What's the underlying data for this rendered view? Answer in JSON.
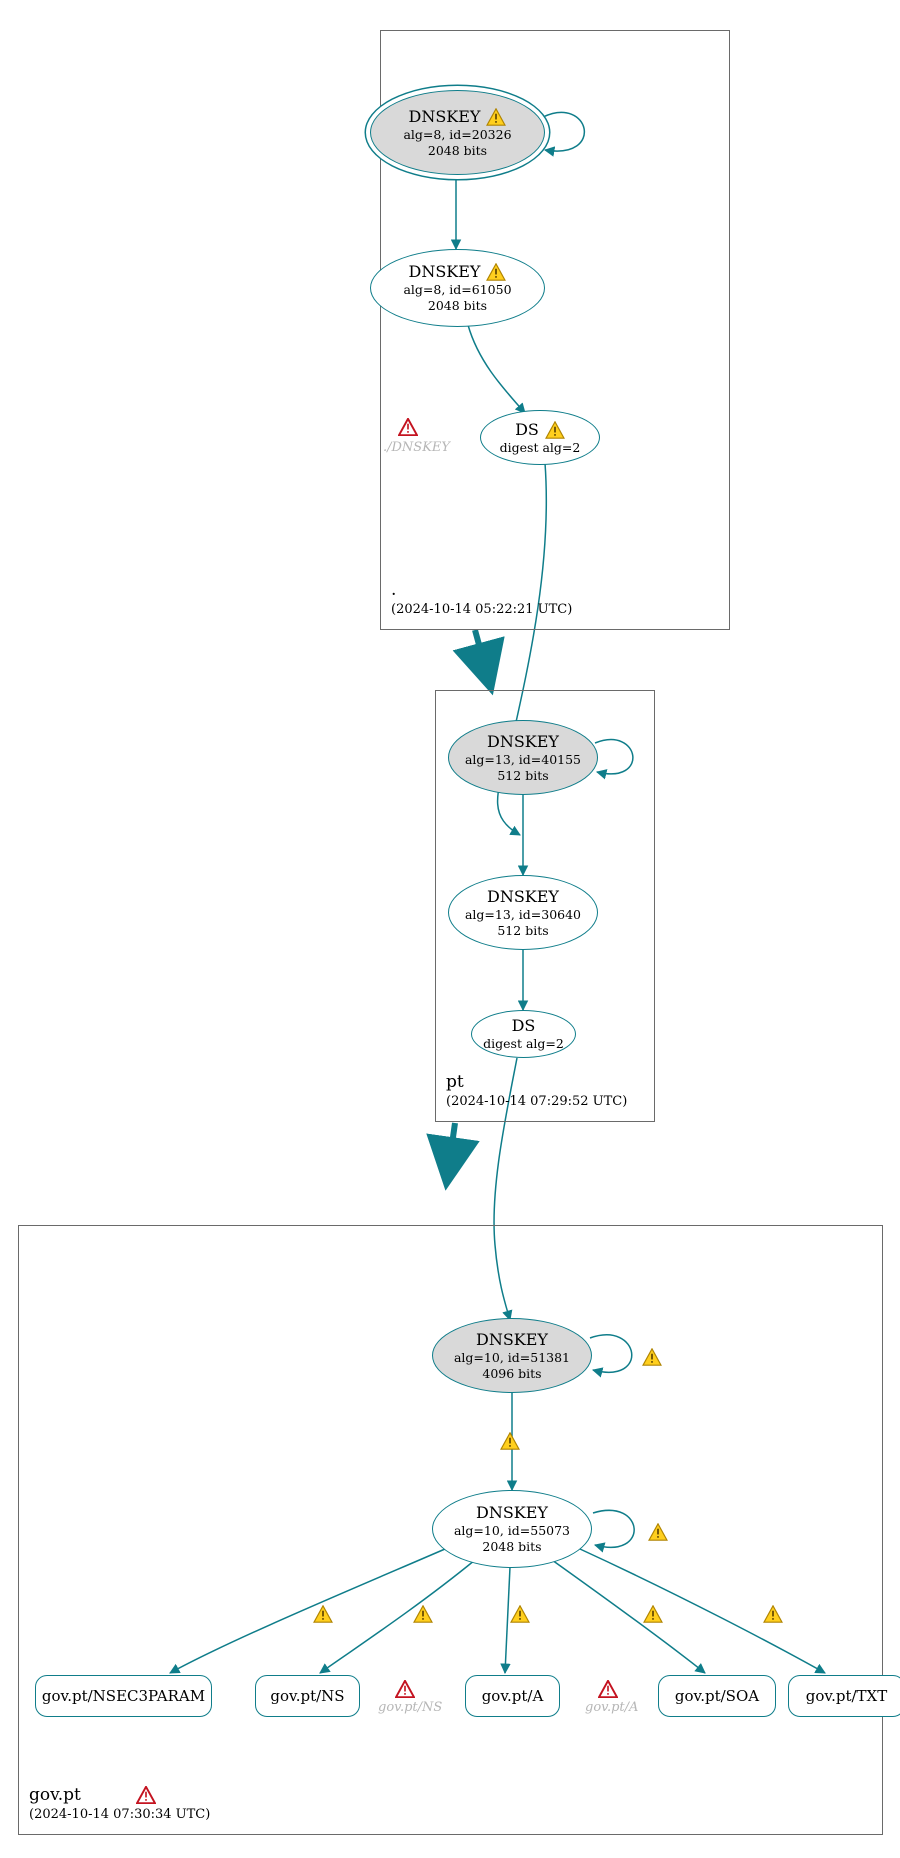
{
  "colors": {
    "teal": "#0f7d8a",
    "ghost": "#b6b6b6"
  },
  "zones": {
    "root": {
      "name": ".",
      "timestamp": "(2024-10-14 05:22:21 UTC)"
    },
    "pt": {
      "name": "pt",
      "timestamp": "(2024-10-14 07:29:52 UTC)"
    },
    "govpt": {
      "name": "gov.pt",
      "timestamp": "(2024-10-14 07:30:34 UTC)"
    }
  },
  "nodes": {
    "root_ksk": {
      "title": "DNSKEY",
      "meta1": "alg=8, id=20326",
      "meta2": "2048 bits",
      "warn": "yellow"
    },
    "root_zsk": {
      "title": "DNSKEY",
      "meta1": "alg=8, id=61050",
      "meta2": "2048 bits",
      "warn": "yellow"
    },
    "root_ds": {
      "title": "DS",
      "meta1": "digest alg=2",
      "warn": "yellow"
    },
    "pt_ksk": {
      "title": "DNSKEY",
      "meta1": "alg=13, id=40155",
      "meta2": "512 bits"
    },
    "pt_zsk": {
      "title": "DNSKEY",
      "meta1": "alg=13, id=30640",
      "meta2": "512 bits"
    },
    "pt_ds": {
      "title": "DS",
      "meta1": "digest alg=2"
    },
    "gov_ksk": {
      "title": "DNSKEY",
      "meta1": "alg=10, id=51381",
      "meta2": "4096 bits"
    },
    "gov_zsk": {
      "title": "DNSKEY",
      "meta1": "alg=10, id=55073",
      "meta2": "2048 bits"
    },
    "rr_n3p": {
      "label": "gov.pt/NSEC3PARAM"
    },
    "rr_ns": {
      "label": "gov.pt/NS"
    },
    "rr_a": {
      "label": "gov.pt/A"
    },
    "rr_soa": {
      "label": "gov.pt/SOA"
    },
    "rr_txt": {
      "label": "gov.pt/TXT"
    }
  },
  "ghosts": {
    "root_dnskey": "./DNSKEY",
    "gov_ns": "gov.pt/NS",
    "gov_a": "gov.pt/A"
  },
  "icons": {
    "warn_yellow": "warning-icon",
    "warn_red": "error-icon"
  }
}
